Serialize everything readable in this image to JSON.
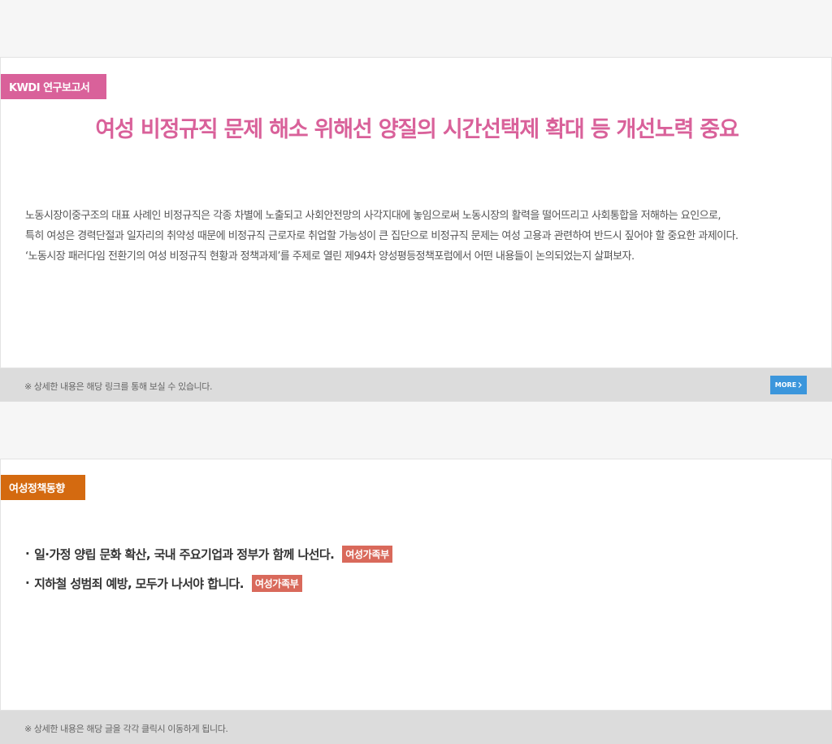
{
  "report_section": {
    "tag": "KWDI 연구보고서",
    "headline": "여성 비정규직 문제 해소 위해선 양질의 시간선택제 확대 등 개선노력 중요",
    "paragraph_lines": [
      "노동시장이중구조의 대표 사례인 비정규직은 각종 차별에 노출되고 사회안전망의 사각지대에 놓임으로써 노동시장의 활력을 떨어뜨리고 사회통합을 저해하는 요인으로,",
      "특히 여성은 경력단절과 일자리의 취약성 때문에 비정규직 근로자로 취업할 가능성이 큰 집단으로 비정규직 문제는 여성 고용과 관련하여 반드시 짚어야 할 중요한 과제이다.",
      "‘노동시장 패러다임 전환기의 여성 비정규직 현황과 정책과제’를 주제로 열린 제94차 양성평등정책포럼에서 어떤 내용들이 논의되었는지 살펴보자."
    ],
    "footer_note": "※ 상세한 내용은 해당 링크를 통해 보실 수 있습니다.",
    "more_label": "MORE",
    "more_icon": "chevron-right-icon"
  },
  "policy_section": {
    "tag": "여성정책동향",
    "items": [
      {
        "bullet": "·",
        "title": "일·가정 양립 문화 확산, 국내 주요기업과 정부가 함께 나선다.",
        "source": "여성가족부"
      },
      {
        "bullet": "·",
        "title": "지하철 성범죄 예방, 모두가 나서야 합니다.",
        "source": "여성가족부"
      }
    ],
    "footer_note": "※ 상세한 내용은 해당 글을 각각 클릭시 이동하게 됩니다."
  },
  "colors": {
    "report_accent": "#d9619a",
    "policy_accent": "#d46a10",
    "source_badge": "#d9695b",
    "more_button": "#3b96dc",
    "footer_bar": "#dcdcdc"
  }
}
